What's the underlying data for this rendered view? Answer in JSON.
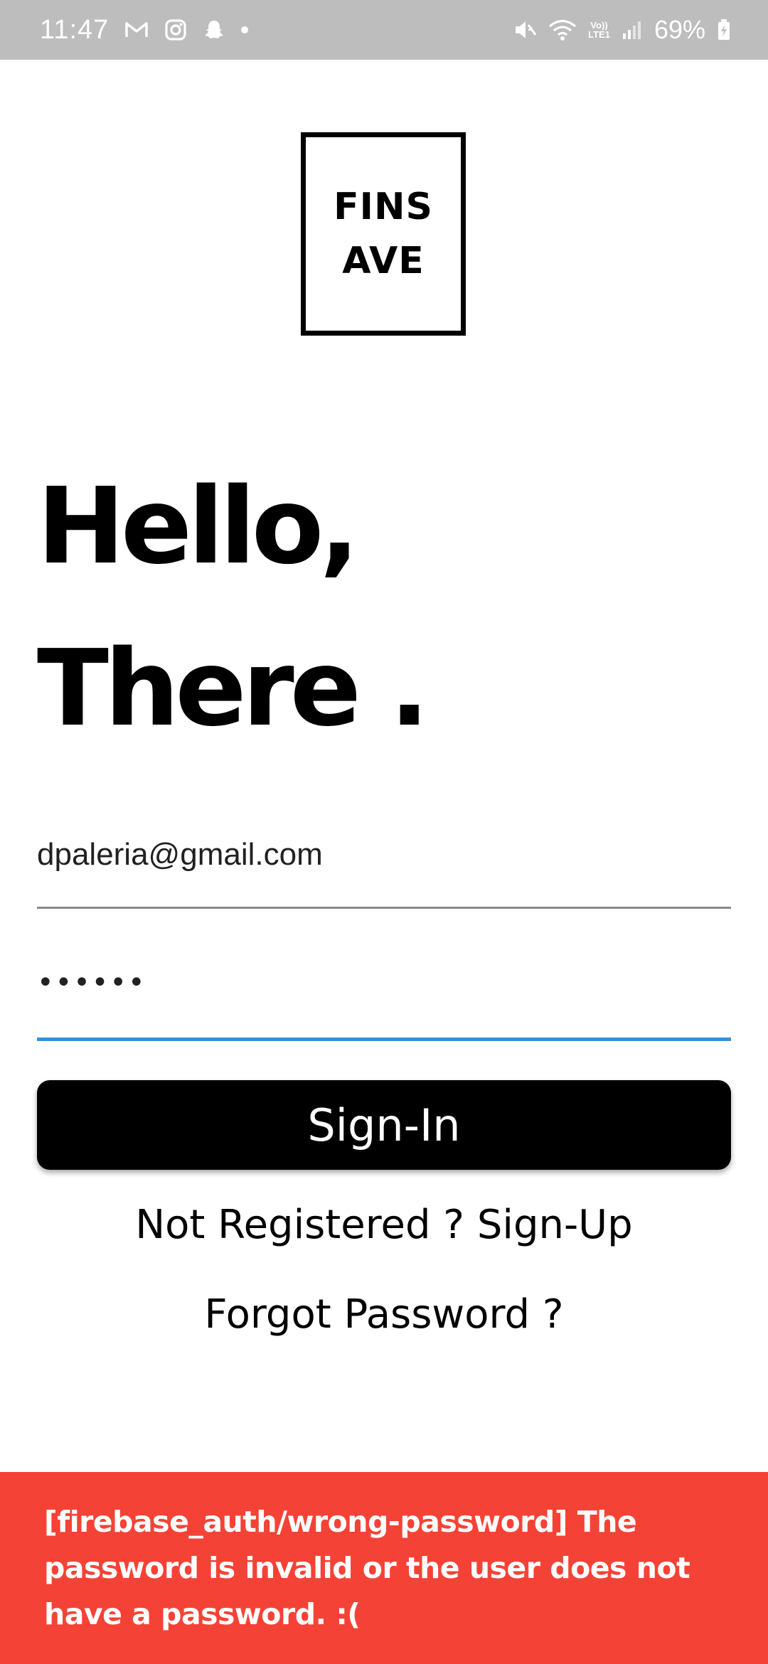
{
  "status_bar": {
    "time": "11:47",
    "left_icons": [
      "gmail-icon",
      "instagram-icon",
      "snapchat-icon",
      "notification-dot-icon"
    ],
    "right_icons": [
      "mute-icon",
      "wifi-icon",
      "volte-lte-icon",
      "signal-icon",
      "battery-charging-icon"
    ],
    "lte_top": "Vo))",
    "lte_bottom": "LTE1",
    "battery_percent": "69%"
  },
  "logo": {
    "line1": "FINS",
    "line2": "AVE"
  },
  "greeting": {
    "line1": "Hello,",
    "line2": "There ."
  },
  "form": {
    "email_value": "dpaleria@gmail.com",
    "password_masked": "••••••"
  },
  "actions": {
    "signin_label": "Sign-In",
    "signup_link": "Not Registered ? Sign-Up",
    "forgot_link": "Forgot Password ?"
  },
  "snackbar": {
    "message": "[firebase_auth/wrong-password] The password is invalid or the user does not have a password. :(",
    "background": "#f44336"
  },
  "colors": {
    "status_bar_bg": "#bdbdbd",
    "focus_underline": "#3b8fd9",
    "button_bg": "#000000"
  }
}
